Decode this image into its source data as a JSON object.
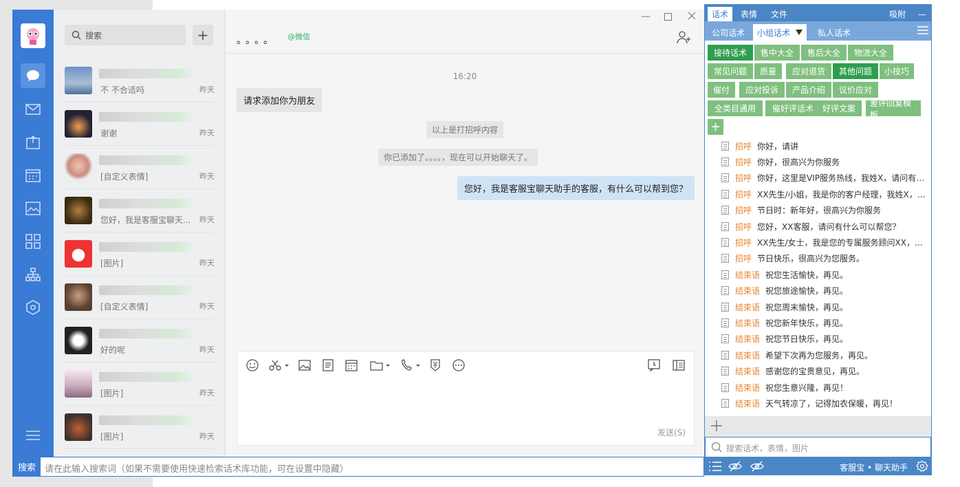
{
  "wechat": {
    "search_placeholder": "搜索",
    "conversations": [
      {
        "last": "不   不合适吗",
        "time": "昨天"
      },
      {
        "last": "谢谢",
        "time": "昨天"
      },
      {
        "last": "[自定义表情]",
        "time": "昨天"
      },
      {
        "last": "您好，我是客服宝聊天...",
        "time": "昨天"
      },
      {
        "last": "[图片]",
        "time": "昨天"
      },
      {
        "last": "[自定义表情]",
        "time": "昨天"
      },
      {
        "last": "好的呢",
        "time": "昨天"
      },
      {
        "last": "[图片]",
        "time": "昨天"
      },
      {
        "last": "[图片]",
        "time": "昨天"
      }
    ],
    "chat": {
      "title": "。。。。",
      "tag": "@微信",
      "time": "16:20",
      "incoming": "请求添加你为朋友",
      "system1": "以上是打招呼内容",
      "system2": "你已添加了。。。。，现在可以开始聊天了。",
      "outgoing": "您好，我是客服宝聊天助手的客服，有什么可以帮到您？",
      "send": "发送(S)"
    },
    "bottom_search": {
      "label": "搜索",
      "placeholder": "请在此输入搜索词（如果不需要使用快速检索话术库功能，可在设置中隐藏）"
    }
  },
  "assistant": {
    "top_tabs": [
      "话术",
      "表情",
      "文件"
    ],
    "attach": "吸附",
    "minimize": "—",
    "sub_tabs": [
      "公司话术",
      "小组话术",
      "私人话术"
    ],
    "tags": [
      "接待话术",
      "售中大全",
      "售后大全",
      "物流大全",
      "常见问题",
      "质量",
      "应对退货",
      "其他问题",
      "小技巧",
      "催付",
      "应对投诉",
      "产品介绍",
      "议价应对",
      "全类目通用",
      "催好评话术",
      "好评文案",
      "差评回复模板"
    ],
    "items": [
      {
        "cat": "招呼",
        "text": "你好，请讲"
      },
      {
        "cat": "招呼",
        "text": "你好，很高兴为你服务"
      },
      {
        "cat": "招呼",
        "text": "你好，这里是VIP服务热线，我姓X，请问有什..."
      },
      {
        "cat": "招呼",
        "text": "XX先生/小姐，我是你的客户经理，我姓X，很..."
      },
      {
        "cat": "招呼",
        "text": "节日时：新年好，很高兴为你服务"
      },
      {
        "cat": "招呼",
        "text": "您好，XX客服，请问有什么可以帮您？"
      },
      {
        "cat": "招呼",
        "text": "XX先生/女士，我是您的专属服务顾问XX，很..."
      },
      {
        "cat": "招呼",
        "text": "节日快乐，很高兴为您服务。"
      },
      {
        "cat": "结束语",
        "text": "祝您生活愉快，再见。"
      },
      {
        "cat": "结束语",
        "text": "祝您旅途愉快，再见。"
      },
      {
        "cat": "结束语",
        "text": "祝您周末愉快，再见。"
      },
      {
        "cat": "结束语",
        "text": "祝您新年快乐，再见。"
      },
      {
        "cat": "结束语",
        "text": "祝您节日快乐，再见。"
      },
      {
        "cat": "结束语",
        "text": "希望下次再为您服务，再见。"
      },
      {
        "cat": "结束语",
        "text": "感谢您的宝贵意见，再见。"
      },
      {
        "cat": "结束语",
        "text": "祝您生意兴隆，再见！"
      },
      {
        "cat": "结束语",
        "text": "天气转凉了，记得加衣保暖，再见！"
      }
    ],
    "search_placeholder": "搜索话术，表情，图片",
    "brand": "客服宝 • 聊天助手"
  }
}
